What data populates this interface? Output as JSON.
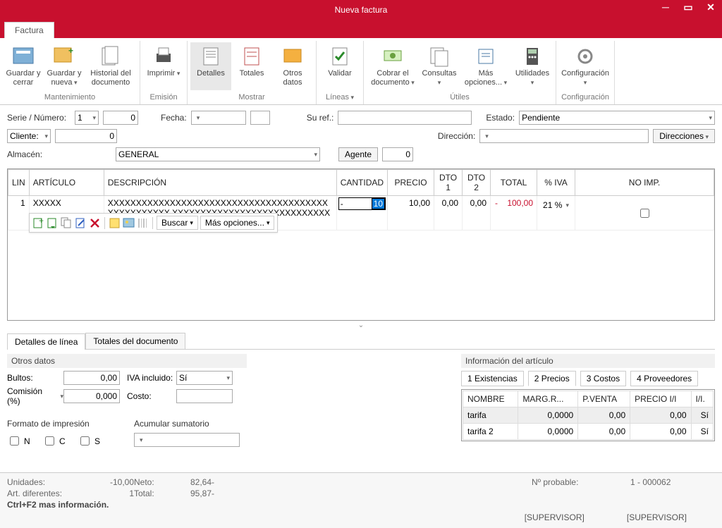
{
  "window": {
    "title": "Nueva factura"
  },
  "tab": {
    "main": "Factura"
  },
  "ribbon": {
    "guardar_cerrar": "Guardar y cerrar",
    "guardar_nueva": "Guardar y nueva",
    "historial": "Historial del documento",
    "imprimir": "Imprimir",
    "detalles": "Detalles",
    "totales": "Totales",
    "otros_datos": "Otros datos",
    "validar": "Validar",
    "cobrar": "Cobrar el documento",
    "consultas": "Consultas",
    "mas_opciones": "Más opciones...",
    "utilidades": "Utilidades",
    "configuracion": "Configuración",
    "grp_mantenimiento": "Mantenimiento",
    "grp_emision": "Emisión",
    "grp_mostrar": "Mostrar",
    "grp_lineas": "Líneas",
    "grp_utiles": "Útiles",
    "grp_config": "Configuración"
  },
  "form": {
    "serie_label": "Serie / Número:",
    "serie_val": "1",
    "numero_val": "0",
    "fecha_label": "Fecha:",
    "fecha_val": "",
    "fecha2_val": "",
    "suref_label": "Su ref.:",
    "suref_val": "",
    "estado_label": "Estado:",
    "estado_val": "Pendiente",
    "cliente_label": "Cliente:",
    "cliente_val": "0",
    "direccion_label": "Dirección:",
    "direccion_val": "",
    "direcciones_btn": "Direcciones",
    "almacen_label": "Almacén:",
    "almacen_val": "GENERAL",
    "agente_btn": "Agente",
    "agente_val": "0"
  },
  "grid": {
    "cols": {
      "lin": "LIN",
      "articulo": "ARTÍCULO",
      "descripcion": "DESCRIPCIÓN",
      "cantidad": "CANTIDAD",
      "precio": "PRECIO",
      "dto1": "DTO 1",
      "dto2": "DTO 2",
      "total": "TOTAL",
      "pctiva": "% IVA",
      "noimp": "NO IMP."
    },
    "row": {
      "lin": "1",
      "articulo": "XXXXX",
      "descripcion": "XXXXXXXXXXXXXXXXXXXXXXXXXXXXXXXXXXXXXXXXXXXXXXXXXX XXXXXXXXXXXXXXXXXXXXXXXXXXXXXXXXXXXXXXXXXXXXXXXXXX",
      "cantidad_prefix": "-",
      "cantidad_sel": "10",
      "precio": "10,00",
      "dto1": "0,00",
      "dto2": "0,00",
      "total_prefix": "-",
      "total": "100,00",
      "pctiva": "21 %"
    },
    "toolbar": {
      "buscar": "Buscar",
      "mas_opciones": "Más opciones..."
    }
  },
  "bottom_tabs": {
    "detalles": "Detalles de línea",
    "totales": "Totales del documento"
  },
  "otros": {
    "title": "Otros datos",
    "bultos_label": "Bultos:",
    "bultos_val": "0,00",
    "iva_label": "IVA incluido:",
    "iva_val": "Sí",
    "comision_label": "Comisión (%)",
    "comision_val": "0,000",
    "costo_label": "Costo:",
    "costo_val": "",
    "formato_label": "Formato de impresión",
    "chk_n": "N",
    "chk_c": "C",
    "chk_s": "S",
    "acumular_label": "Acumular sumatorio",
    "acumular_val": ""
  },
  "info": {
    "title": "Información del artículo",
    "t1": "1 Existencias",
    "t2": "2 Precios",
    "t3": "3 Costos",
    "t4": "4 Proveedores",
    "cols": {
      "nombre": "NOMBRE",
      "marg": "MARG.R...",
      "pventa": "P.VENTA",
      "precioii": "PRECIO I/I",
      "ii": "I/I."
    },
    "rows": [
      {
        "nombre": "tarifa",
        "marg": "0,0000",
        "pventa": "0,00",
        "precioii": "0,00",
        "ii": "Sí"
      },
      {
        "nombre": "tarifa 2",
        "marg": "0,0000",
        "pventa": "0,00",
        "precioii": "0,00",
        "ii": "Sí"
      }
    ]
  },
  "footer": {
    "unidades_label": "Unidades:",
    "unidades_val": "-10,00",
    "neto_label": "Neto:",
    "neto_val": "82,64-",
    "art_label": "Art. diferentes:",
    "art_val": "1",
    "total_label": "Total:",
    "total_val": "95,87-",
    "probable_label": "Nº probable:",
    "probable_val": "1 - 000062",
    "hint": "Ctrl+F2 mas información."
  },
  "status": {
    "s1": "[SUPERVISOR]",
    "s2": "[SUPERVISOR]"
  }
}
